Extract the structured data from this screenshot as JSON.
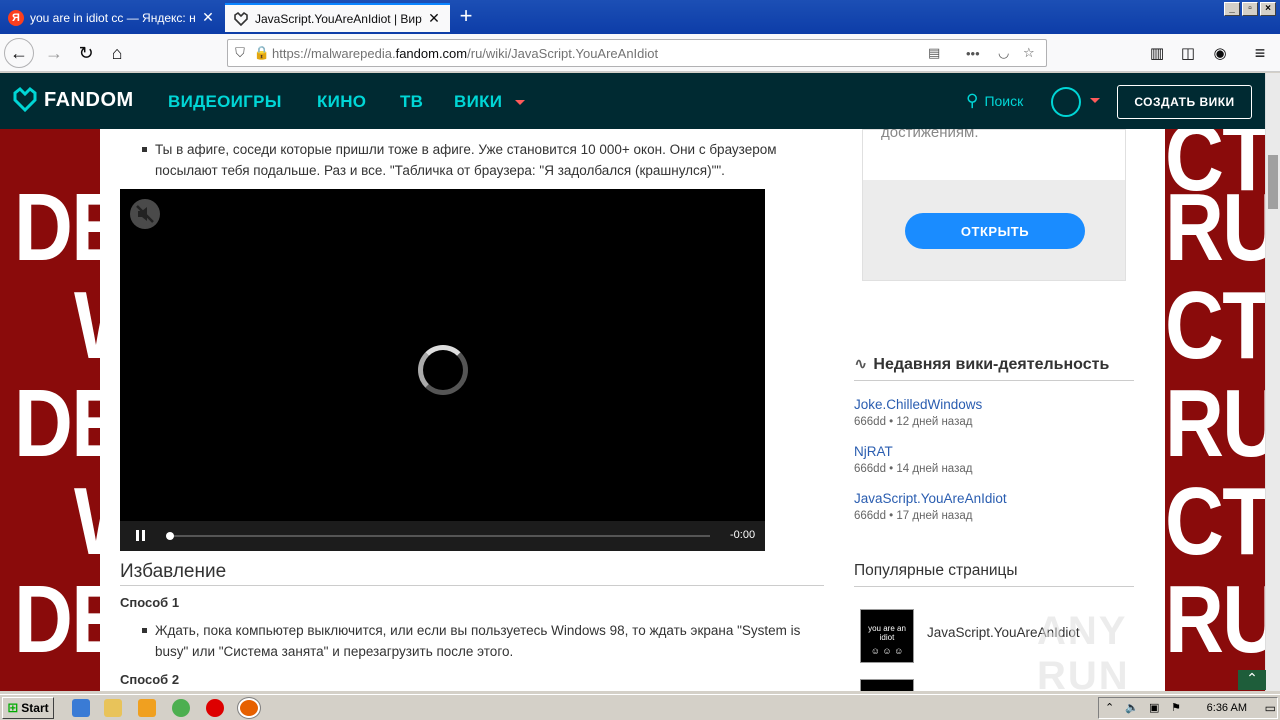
{
  "browser": {
    "tabs": [
      {
        "title": "you are in idiot cc — Яндекс: наш",
        "active": false
      },
      {
        "title": "JavaScript.YouAreAnIdiot | Вирус",
        "active": true
      }
    ],
    "url_prefix": "https://malwarepedia.",
    "url_domain": "fandom.com",
    "url_path": "/ru/wiki/JavaScript.YouAreAnIdiot"
  },
  "fandom_header": {
    "logo": "FANDOM",
    "nav": [
      "ВИДЕОИГРЫ",
      "КИНО",
      "ТВ",
      "ВИКИ"
    ],
    "search_label": "Поиск",
    "create_label": "СОЗДАТЬ ВИКИ"
  },
  "background_words": [
    "DET",
    "W",
    "DET",
    "W",
    "DET",
    "CTI",
    "RUS",
    "CTI",
    "RUS",
    "CTI",
    "RUS"
  ],
  "article": {
    "bullet1": "Ты в афиге, соседи которые пришли тоже в афиге. Уже становится 10 000+ окон. Они с браузером посылают тебя подальше. Раз и все. \"Табличка от браузера: \"Я задолбался (крашнулся)\"\".",
    "video_time": "-0:00",
    "heading": "Избавление",
    "method1": "Способ 1",
    "bullet2": "Ждать, пока компьютер выключится, или если вы пользуетесь Windows 98, то ждать экрана \"System is busy\" или \"Система занята\" и перезагрузить после этого.",
    "method2": "Способ 2"
  },
  "rail": {
    "ad_text": "достижениям.",
    "ad_button": "ОТКРЫТЬ",
    "activity_title": "Недавняя вики-деятельность",
    "activity": [
      {
        "page": "Joke.ChilledWindows",
        "meta": "666dd • 12 дней назад"
      },
      {
        "page": "NjRAT",
        "meta": "666dd • 14 дней назад"
      },
      {
        "page": "JavaScript.YouAreAnIdiot",
        "meta": "666dd • 17 дней назад"
      }
    ],
    "popular_title": "Популярные страницы",
    "popular": [
      {
        "label": "JavaScript.YouAreAnIdiot",
        "thumb_text": "you are an idiot"
      }
    ]
  },
  "watermark": "ANY RUN",
  "taskbar": {
    "start": "Start",
    "clock": "6:36 AM"
  }
}
